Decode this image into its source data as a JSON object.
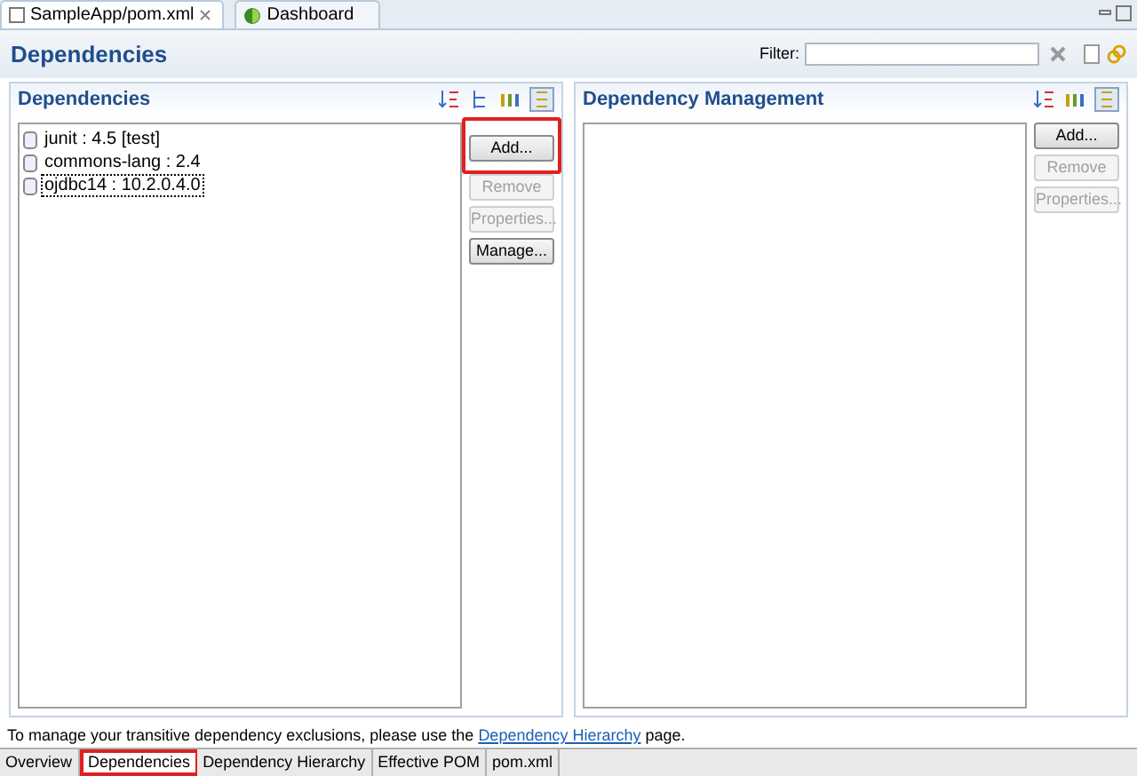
{
  "editor_tabs": [
    {
      "label": "SampleApp/pom.xml",
      "selected": true,
      "closable": true,
      "kind": "xml"
    },
    {
      "label": "Dashboard",
      "selected": false,
      "closable": false,
      "kind": "dashboard"
    }
  ],
  "page_title": "Dependencies",
  "filter": {
    "label": "Filter:"
  },
  "sections": [
    {
      "title": "Dependencies",
      "toolbar": [
        {
          "kind": "sort"
        },
        {
          "kind": "hierarchy"
        },
        {
          "kind": "columns"
        },
        {
          "kind": "toggle"
        }
      ],
      "items": [
        {
          "label": "junit : 4.5 [test]",
          "focused": false
        },
        {
          "label": "commons-lang : 2.4",
          "focused": false
        },
        {
          "label": "ojdbc14 : 10.2.0.4.0",
          "focused": true
        }
      ],
      "buttons": [
        {
          "label": "Add...",
          "disabled": false,
          "highlighted": true
        },
        {
          "label": "Remove",
          "disabled": true,
          "highlighted": false
        },
        {
          "label": "Properties...",
          "disabled": true,
          "highlighted": false
        },
        {
          "label": "Manage...",
          "disabled": false,
          "highlighted": false
        }
      ]
    },
    {
      "title": "Dependency Management",
      "toolbar": [
        {
          "kind": "sort"
        },
        {
          "kind": "columns"
        },
        {
          "kind": "toggle"
        }
      ],
      "buttons": [
        {
          "label": "Add...",
          "disabled": false,
          "highlighted": false
        },
        {
          "label": "Remove",
          "disabled": true,
          "highlighted": false
        },
        {
          "label": "Properties...",
          "disabled": true,
          "highlighted": false
        }
      ]
    }
  ],
  "hint": {
    "before": "To manage your transitive dependency exclusions, please use the",
    "link": "Dependency Hierarchy",
    "after": "page."
  },
  "page_tabs": [
    {
      "label": "Overview",
      "selected": false,
      "highlighted": false
    },
    {
      "label": "Dependencies",
      "selected": true,
      "highlighted": true
    },
    {
      "label": "Dependency Hierarchy",
      "selected": false,
      "highlighted": false
    },
    {
      "label": "Effective POM",
      "selected": false,
      "highlighted": false
    },
    {
      "label": "pom.xml",
      "selected": false,
      "highlighted": false
    }
  ]
}
